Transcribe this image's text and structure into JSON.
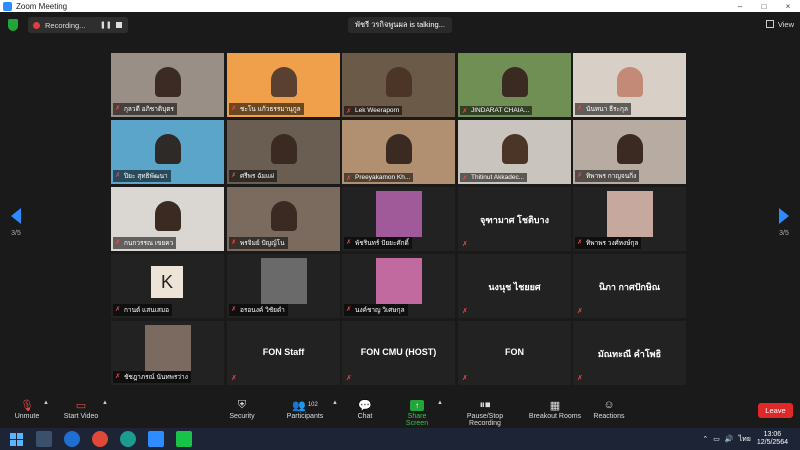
{
  "window": {
    "title": "Zoom Meeting",
    "controls": [
      "–",
      "□",
      "×"
    ]
  },
  "topbar": {
    "recording_label": "Recording...",
    "talking_label": "พัชรี วรกิจพูนผล is talking...",
    "view_label": "View"
  },
  "pager": {
    "left_page": "3/5",
    "right_page": "3/5"
  },
  "tiles": [
    {
      "kind": "video",
      "name": "กุลวดี อภิชาติบุตร",
      "bg": "#9a8f86",
      "skin": "#3b2b24"
    },
    {
      "kind": "video",
      "name": "ชะโน แก้วธรรมานุกูล",
      "bg": "#f0a04a",
      "skin": "#5a4030"
    },
    {
      "kind": "video",
      "name": "Lek Weeraporn",
      "bg": "#6b5a48",
      "skin": "#4a3526"
    },
    {
      "kind": "video",
      "name": "JINDARAT CHAIA...",
      "bg": "#6f8f55",
      "skin": "#3a2a22"
    },
    {
      "kind": "video",
      "name": "นันทนา ธีระกุล",
      "bg": "#d8cfc6",
      "skin": "#c48a78"
    },
    {
      "kind": "video",
      "name": "ปิยะ สุทธิพัฒนา",
      "bg": "#5aa5c9",
      "skin": "#2e2a28"
    },
    {
      "kind": "video",
      "name": "ศรีพร ฉัมแฝ",
      "bg": "#6a5e52",
      "skin": "#3a2a22"
    },
    {
      "kind": "video",
      "name": "Preeyakamon Kh...",
      "bg": "#b09070",
      "skin": "#3a2a22"
    },
    {
      "kind": "video",
      "name": "Thitinut Akkadec...",
      "bg": "#c9c4bd",
      "skin": "#4a3526"
    },
    {
      "kind": "video",
      "name": "ทิพาพร กาญจนกิ่ง",
      "bg": "#b8aca2",
      "skin": "#3a2a22"
    },
    {
      "kind": "video",
      "name": "กนกวรรณ เขยคว",
      "bg": "#dad6d2",
      "skin": "#3a2a22"
    },
    {
      "kind": "video",
      "name": "พรจิมย์ ปัญญ์โน",
      "bg": "#7b6b5f",
      "skin": "#3a2a22"
    },
    {
      "kind": "photo",
      "name": "พัชรินทร์ ปัยยะศักดิ์",
      "pic": "#a05a9a"
    },
    {
      "kind": "text",
      "name": "จุฑามาศ โชติบาง"
    },
    {
      "kind": "photo",
      "name": "ทิพาพร วงศ์หงษ์กุล",
      "pic": "#c7a89e"
    },
    {
      "kind": "letter",
      "name": "กานต์ แสนเสมอ",
      "letter": "K"
    },
    {
      "kind": "photo",
      "name": "อรอนงค์ วิชัยดำ",
      "pic": "#6a6a6a"
    },
    {
      "kind": "photo",
      "name": "นงค์ชาญ วิเศษกุล",
      "pic": "#c06aa0"
    },
    {
      "kind": "text",
      "name": "นงนุช ไชยยศ"
    },
    {
      "kind": "text",
      "name": "นิภา กาศปักษิณ"
    },
    {
      "kind": "photo",
      "name": "ชัชฎาภรณ์ นันทพรว่าง",
      "pic": "#7a6a60"
    },
    {
      "kind": "text",
      "name": "FON Staff"
    },
    {
      "kind": "text",
      "name": "FON CMU (HOST)"
    },
    {
      "kind": "text",
      "name": "FON"
    },
    {
      "kind": "text",
      "name": "มัณทะณี คำโพธิ"
    }
  ],
  "toolbar": {
    "unmute": "Unmute",
    "start_video": "Start Video",
    "security": "Security",
    "participants": "Participants",
    "participants_count": "102",
    "chat": "Chat",
    "share_screen": "Share Screen",
    "pause_recording": "Pause/Stop Recording",
    "breakout": "Breakout Rooms",
    "reactions": "Reactions",
    "leave": "Leave"
  },
  "taskbar": {
    "lang": "ไทย",
    "time": "13:06",
    "date": "12/5/2564"
  },
  "colors": {
    "accent": "#2d8cff",
    "leave": "#e02828",
    "share": "#23a639",
    "muted": "#e34b4b"
  }
}
